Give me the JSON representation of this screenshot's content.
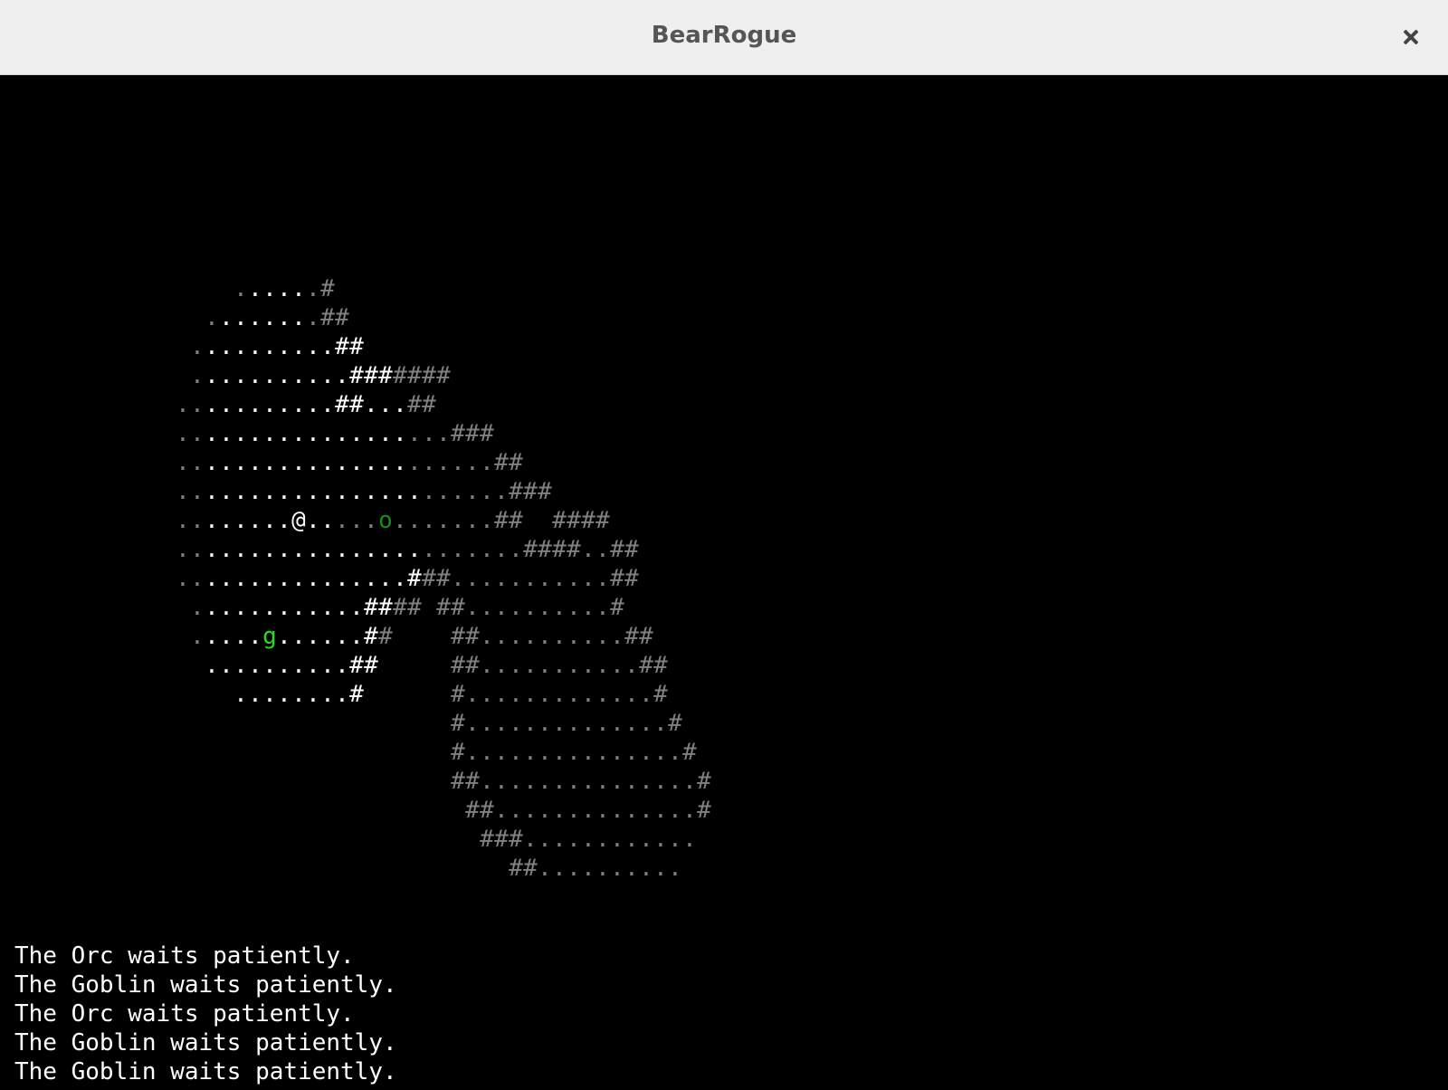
{
  "window": {
    "title": "BearRogue",
    "close_icon": "close-icon"
  },
  "map": {
    "legend": {
      "lit_color": "#ffffff",
      "dim_color": "#808080",
      "orc_color": "#1a8a1a",
      "goblin_color": "#22dd22",
      "player_glyph": "@",
      "orc_glyph": "o",
      "goblin_glyph": "g"
    },
    "rows": [
      "                ......#",
      "              ........##",
      "             ..........##",
      "             ...........#######",
      "            ...........##...##",
      "            ...................###",
      "            ......................##",
      "            .......................###",
      "            ........@.....o.......##  ####",
      "            ........................####..##",
      "            ................###...........##",
      "             ............#### ##..........#",
      "             .....g......##    ##..........##",
      "              ..........##     ##...........##",
      "                ........#      #.............#",
      "                               #..............#",
      "                               #...............#",
      "                               ##...............#",
      "                                ##..............#",
      "                                 ###............",
      "                                   ##.........."
    ],
    "lit_mask": [
      "                 ....",
      "               ......",
      "              .........##",
      "              ...........##",
      "              ...........##.",
      "              ..............",
      "              ..............",
      "              ...............",
      "              ..@.....o",
      "              ...............",
      "              ...............",
      "              ...........##",
      "              ...g......##",
      "              ..........##",
      "                ........#"
    ]
  },
  "message_log": [
    "The Orc waits patiently.",
    "The Goblin waits patiently.",
    "The Orc waits patiently.",
    "The Goblin waits patiently.",
    "The Goblin waits patiently."
  ]
}
